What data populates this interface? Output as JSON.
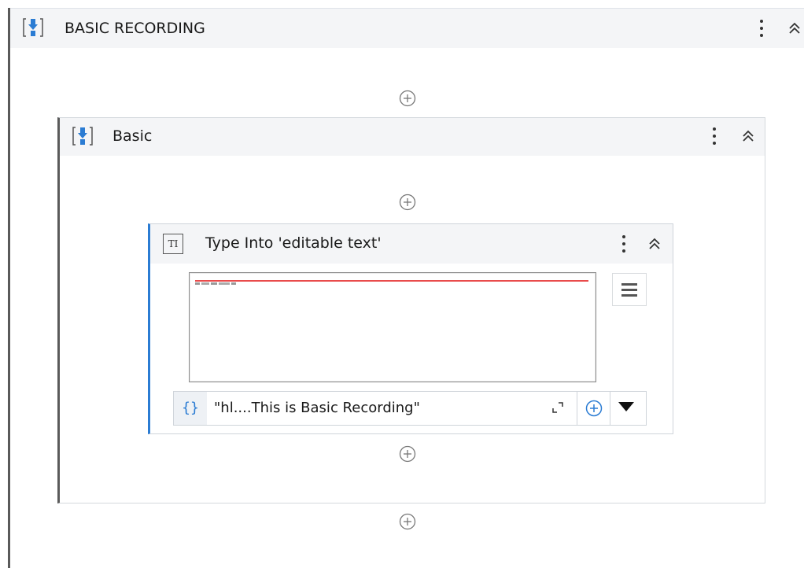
{
  "outer_sequence": {
    "title": "BASIC RECORDING",
    "icon": "sequence-icon"
  },
  "inner_sequence": {
    "title": "Basic",
    "icon": "sequence-icon"
  },
  "activity": {
    "title": "Type Into 'editable text'",
    "icon_text": "TI",
    "text_value": "\"hl....This is Basic Recording\"",
    "menu": "hamburger-menu-icon"
  },
  "colors": {
    "accent": "#2b7cd3",
    "selection_line": "#e94b4b",
    "header_bg": "#f4f5f7"
  }
}
